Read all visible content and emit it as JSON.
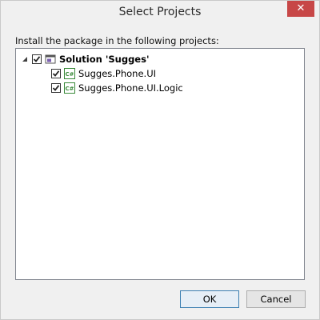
{
  "window": {
    "title": "Select Projects",
    "close_glyph": "✕"
  },
  "instruction": "Install the package in the following projects:",
  "tree": {
    "root": {
      "label": "Solution 'Sugges'",
      "checked": true,
      "expanded": true,
      "icon": "solution-icon"
    },
    "children": [
      {
        "label": "Sugges.Phone.UI",
        "checked": true,
        "icon": "csharp-project-icon"
      },
      {
        "label": "Sugges.Phone.UI.Logic",
        "checked": true,
        "icon": "csharp-project-icon"
      }
    ]
  },
  "buttons": {
    "ok_label": "OK",
    "cancel_label": "Cancel"
  },
  "colors": {
    "close_button": "#c74747",
    "project_icon_green": "#3a8a3a",
    "ok_border": "#3c7fb1"
  }
}
